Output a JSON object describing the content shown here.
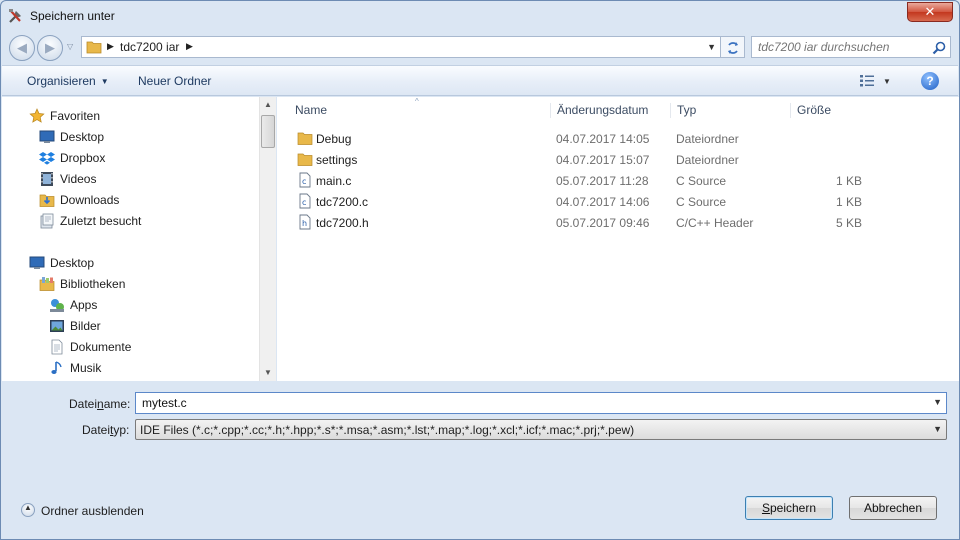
{
  "window": {
    "title": "Speichern unter",
    "close_glyph": "✕"
  },
  "navigation": {
    "back_glyph": "◀",
    "forward_glyph": "▶",
    "address": {
      "path_folder": "tdc7200 iar"
    },
    "search": {
      "placeholder": "tdc7200 iar durchsuchen"
    }
  },
  "toolbar": {
    "organize_label": "Organisieren",
    "new_folder_label": "Neuer Ordner",
    "help_glyph": "?"
  },
  "sidebar": {
    "favorites": {
      "label": "Favoriten",
      "items": [
        {
          "label": "Desktop",
          "icon": "desktop-icon"
        },
        {
          "label": "Dropbox",
          "icon": "dropbox-icon"
        },
        {
          "label": "Videos",
          "icon": "videos-icon"
        },
        {
          "label": "Downloads",
          "icon": "downloads-icon"
        },
        {
          "label": "Zuletzt besucht",
          "icon": "recent-places-icon"
        }
      ]
    },
    "desktop": {
      "label": "Desktop",
      "libraries": {
        "label": "Bibliotheken",
        "items": [
          {
            "label": "Apps",
            "icon": "apps-icon"
          },
          {
            "label": "Bilder",
            "icon": "pictures-icon"
          },
          {
            "label": "Dokumente",
            "icon": "documents-icon"
          },
          {
            "label": "Musik",
            "icon": "music-icon"
          }
        ]
      }
    }
  },
  "file_list": {
    "columns": {
      "name": "Name",
      "date": "Änderungsdatum",
      "type": "Typ",
      "size": "Größe"
    },
    "rows": [
      {
        "name": "Debug",
        "date": "04.07.2017 14:05",
        "type": "Dateiordner",
        "size": "",
        "icon": "folder-icon"
      },
      {
        "name": "settings",
        "date": "04.07.2017 15:07",
        "type": "Dateiordner",
        "size": "",
        "icon": "folder-icon"
      },
      {
        "name": "main.c",
        "date": "05.07.2017 11:28",
        "type": "C Source",
        "size": "1 KB",
        "icon": "c-source-file-icon"
      },
      {
        "name": "tdc7200.c",
        "date": "04.07.2017 14:06",
        "type": "C Source",
        "size": "1 KB",
        "icon": "c-source-file-icon"
      },
      {
        "name": "tdc7200.h",
        "date": "05.07.2017 09:46",
        "type": "C/C++ Header",
        "size": "5 KB",
        "icon": "header-file-icon"
      }
    ]
  },
  "filename": {
    "label_before": "Datei",
    "label_underlined": "n",
    "label_after": "ame:",
    "value": "mytest.c"
  },
  "filetype": {
    "label_before": "Datei",
    "label_underlined": "t",
    "label_after": "yp:",
    "value": "IDE Files (*.c;*.cpp;*.cc;*.h;*.hpp;*.s*;*.msa;*.asm;*.lst;*.map;*.log;*.xcl;*.icf;*.mac;*.prj;*.pew)"
  },
  "footer": {
    "hide_folders_label": "Ordner ausblenden",
    "save_label_underlined": "S",
    "save_label_rest": "peichern",
    "cancel_label": "Abbrechen"
  },
  "colors": {
    "window_bg": "#dbe6f3",
    "toolbar_text": "#1e3a61",
    "close_button": "#c3371e",
    "folder": "#e8b84a",
    "secondary_text": "#6d6d6d"
  }
}
